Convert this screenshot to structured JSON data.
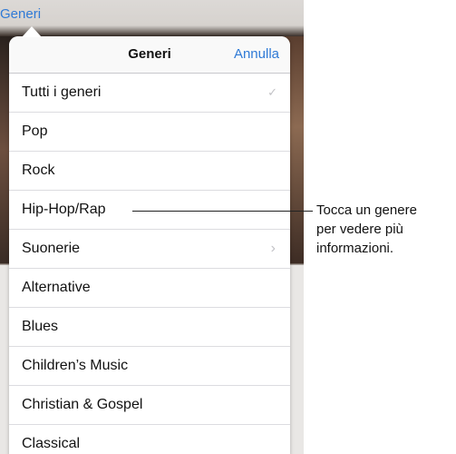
{
  "top_link": "Generi",
  "popover": {
    "title": "Generi",
    "cancel_label": "Annulla",
    "items": [
      {
        "label": "Tutti i generi",
        "accessory": "checkmark-icon",
        "selected": true
      },
      {
        "label": "Pop"
      },
      {
        "label": "Rock"
      },
      {
        "label": "Hip-Hop/Rap"
      },
      {
        "label": "Suonerie",
        "accessory": "chevron-right-icon"
      },
      {
        "label": "Alternative"
      },
      {
        "label": "Blues"
      },
      {
        "label": "Children’s Music"
      },
      {
        "label": "Christian & Gospel"
      },
      {
        "label": "Classical"
      }
    ]
  },
  "callout": {
    "line1": "Tocca un genere",
    "line2": "per vedere più",
    "line3": "informazioni."
  },
  "colors": {
    "accent": "#2f7ad6",
    "separator": "#dcdce0",
    "accessory": "#c2c2c6"
  }
}
